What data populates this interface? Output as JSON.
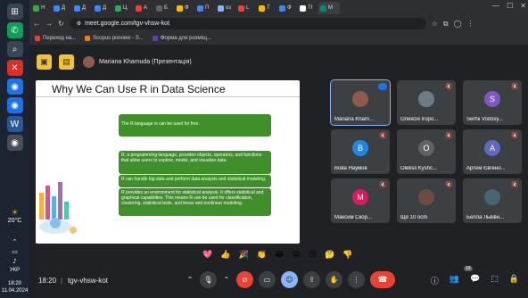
{
  "browser": {
    "url": "meet.google.com/tgv-vhsw-kot",
    "tabs": [
      {
        "label": "H",
        "color": "#34a853"
      },
      {
        "label": "Д",
        "color": "#4285f4"
      },
      {
        "label": "Д",
        "color": "#4285f4"
      },
      {
        "label": "Д",
        "color": "#4285f4"
      },
      {
        "label": "Ц",
        "color": "#34a853"
      },
      {
        "label": "A",
        "color": "#ea4335"
      },
      {
        "label": "Б",
        "color": "#5f6368"
      },
      {
        "label": "Ф",
        "color": "#fbbc04"
      },
      {
        "label": "П",
        "color": "#4285f4"
      },
      {
        "label": "оз",
        "color": "#8ab4f8"
      },
      {
        "label": "L",
        "color": "#ea4335"
      },
      {
        "label": "T",
        "color": "#fbbc04"
      },
      {
        "label": "Ф",
        "color": "#4285f4"
      },
      {
        "label": "TI",
        "color": "#ffffff"
      },
      {
        "label": "M",
        "color": "#00897b"
      }
    ],
    "bookmarks": [
      {
        "label": "Переход на...",
        "color": "#ea4335"
      },
      {
        "label": "Scopus preview - S...",
        "color": "#f57c00"
      },
      {
        "label": "Форма для розміщ...",
        "color": "#673ab7"
      }
    ]
  },
  "taskbar": {
    "weather": "20°C",
    "time": "18:20",
    "date": "11.04.2024",
    "lang": "УКР"
  },
  "meet": {
    "presenter": "Mariana Khamuda (Презентація)",
    "time": "18:20",
    "code": "tgv-vhsw-kot",
    "participants_count": "19",
    "reactions": [
      "💖",
      "👍",
      "🎉",
      "👏",
      "😂",
      "😮",
      "😢",
      "🤔",
      "👎"
    ]
  },
  "slide": {
    "title": "Why We Can Use R in Data Science",
    "boxes": [
      "The R language is can be used for free.",
      "R, a programming language, provides objects, operators, and functions that allow users to explore, model, and visualize data.",
      "R can handle big data and perform data analysis and statistical modeling.",
      "R provides an environment for statistical analysis. It offers statistical and graphical capabilities. This means R can be used for classification, clustering, statistical tests, and linear and nonlinear modeling."
    ]
  },
  "tiles": [
    {
      "name": "Mariana Kham...",
      "avatar": "",
      "color": "#8d5b4c"
    },
    {
      "name": "Олексій Ігоро...",
      "avatar": "",
      "color": "#6b7b8c"
    },
    {
      "name": "Serhii Voitovy...",
      "avatar": "S",
      "color": "#7e57c2"
    },
    {
      "name": "Вова Наумов",
      "avatar": "B",
      "color": "#1e88e5"
    },
    {
      "name": "Oleksii Kyshc...",
      "avatar": "O",
      "color": "#5f6368"
    },
    {
      "name": "Артем Євгено...",
      "avatar": "A",
      "color": "#5c6bc0"
    },
    {
      "name": "Максим Скор...",
      "avatar": "M",
      "color": "#d81b60"
    },
    {
      "name": "Ще 10 осіб",
      "avatar": "",
      "color": "#6d4c41"
    },
    {
      "name": "Белла Львівн...",
      "avatar": "",
      "color": "#4a6572"
    }
  ]
}
